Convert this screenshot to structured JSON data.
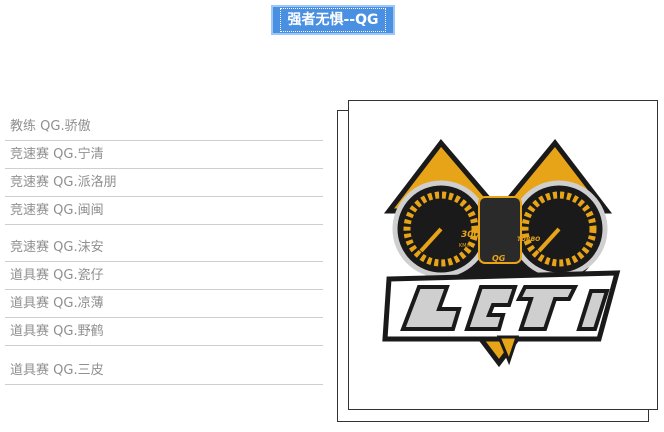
{
  "header": {
    "title": "强者无惧--QG"
  },
  "roster": [
    {
      "label": "教练 QG.骄傲"
    },
    {
      "label": "竞速赛 QG.宁清"
    },
    {
      "label": "竞速赛 QG.派洛朋"
    },
    {
      "label": "竞速赛 QG.闽闽"
    },
    {
      "label": "竞速赛 QG.沫安"
    },
    {
      "label": "道具赛 QG.瓷仔"
    },
    {
      "label": "道具赛 QG.凉薄"
    },
    {
      "label": "道具赛 QG.野鹤"
    },
    {
      "label": "道具赛 QG.三皮"
    }
  ],
  "logo": {
    "gauge_left_text": "300",
    "gauge_left_sub": "KM/H",
    "gauge_right_text": "TURBO",
    "gauge_center_text": "QG",
    "colors": {
      "gold": "#e8a418",
      "dark": "#1a1a1a",
      "silver": "#cfcfcf",
      "accent": "#c77c10"
    }
  }
}
